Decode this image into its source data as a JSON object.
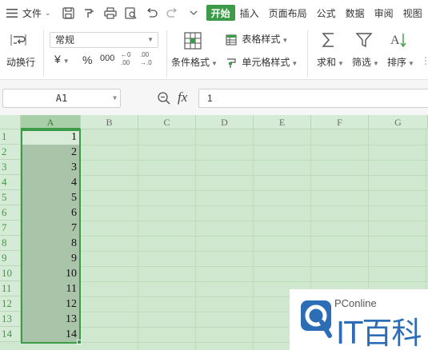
{
  "menubar": {
    "file_label": "文件",
    "tabs": [
      {
        "label": "开始",
        "active": true
      },
      {
        "label": "插入"
      },
      {
        "label": "页面布局"
      },
      {
        "label": "公式"
      },
      {
        "label": "数据"
      },
      {
        "label": "审阅"
      },
      {
        "label": "视图"
      }
    ]
  },
  "ribbon": {
    "wrap_label": "动换行",
    "number_format": "常规",
    "currency_symbol": "¥",
    "percent_symbol": "%",
    "thousands_symbol": "000",
    "conditional_format_label": "条件格式",
    "table_style_label": "表格样式",
    "cell_style_label": "单元格样式",
    "sum_label": "求和",
    "filter_label": "筛选",
    "sort_label": "排序"
  },
  "formula_bar": {
    "name_box": "A1",
    "fx_label": "fx",
    "formula": "1"
  },
  "grid": {
    "columns": [
      "A",
      "B",
      "C",
      "D",
      "E",
      "F",
      "G"
    ],
    "rows": [
      "1",
      "2",
      "3",
      "4",
      "5",
      "6",
      "7",
      "8",
      "9",
      "10",
      "11",
      "12",
      "13",
      "14"
    ],
    "column_a_values": [
      "1",
      "2",
      "3",
      "4",
      "5",
      "6",
      "7",
      "8",
      "9",
      "10",
      "11",
      "12",
      "13",
      "14"
    ]
  },
  "watermark": {
    "brand_small": "PConline",
    "brand_big": "IT百科"
  },
  "colors": {
    "accent": "#3d9b47",
    "grid_bg": "#cfe8cf",
    "selection_fill": "#a9c4a9",
    "watermark_blue": "#2d6db5"
  }
}
